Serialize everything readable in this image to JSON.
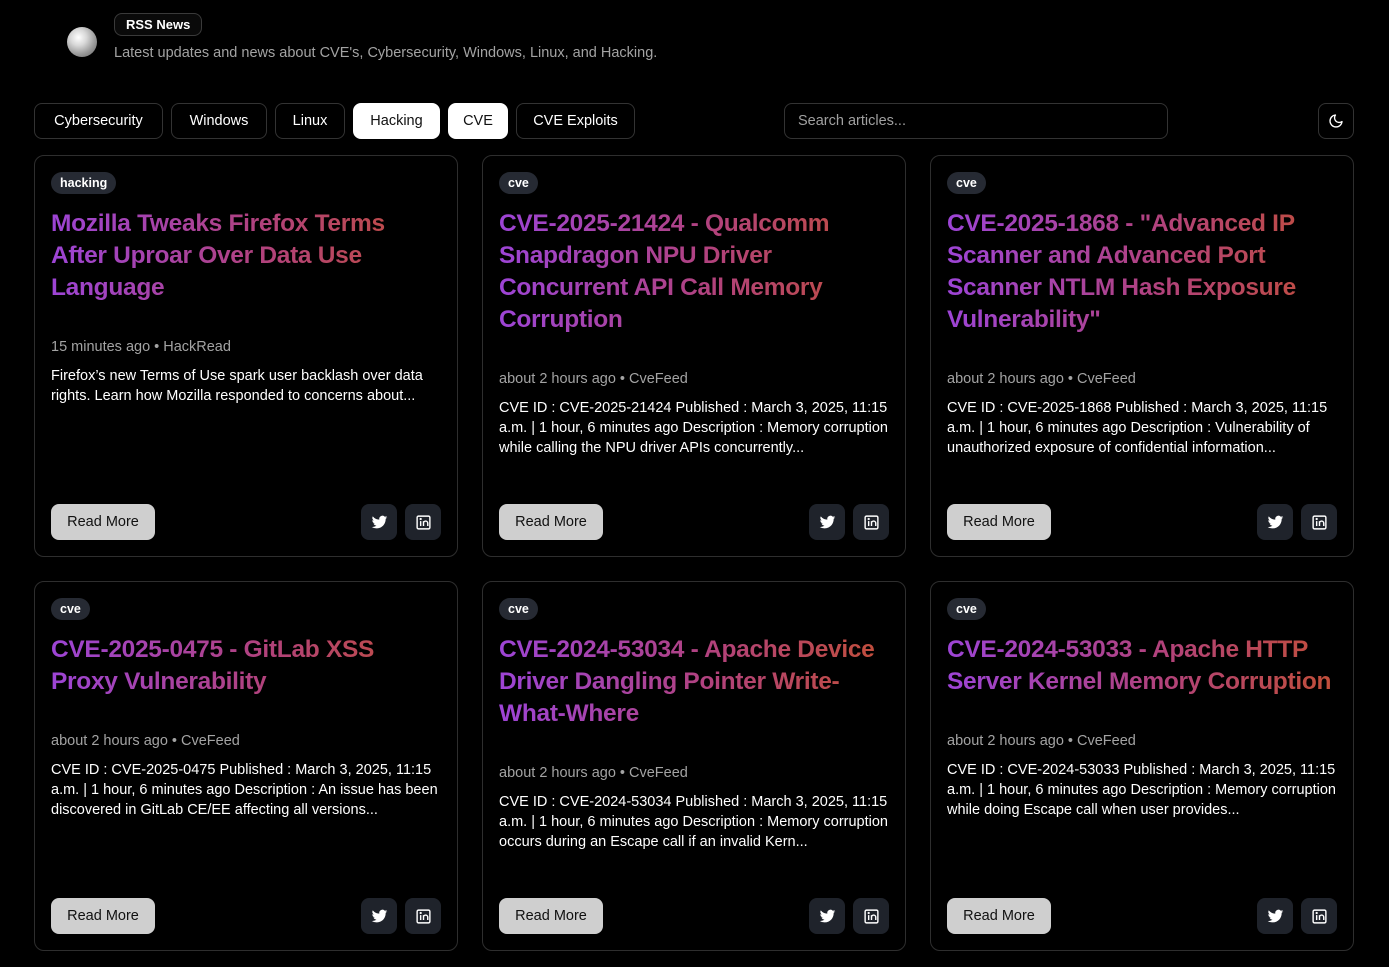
{
  "header": {
    "brand": "RSS News",
    "tagline": "Latest updates and news about CVE's, Cybersecurity, Windows, Linux, and Hacking.",
    "logo_icon": "globe-icon"
  },
  "filters": [
    {
      "label": "Cybersecurity",
      "active": false
    },
    {
      "label": "Windows",
      "active": false
    },
    {
      "label": "Linux",
      "active": false
    },
    {
      "label": "Hacking",
      "active": true
    },
    {
      "label": "CVE",
      "active": true
    },
    {
      "label": "CVE Exploits",
      "active": false
    }
  ],
  "search": {
    "placeholder": "Search articles...",
    "value": ""
  },
  "theme_toggle": {
    "icon": "moon-icon"
  },
  "colors": {
    "background": "#000000",
    "title_gradient_start": "#9d44d6",
    "title_gradient_end": "#c24f36",
    "tag_bg": "#262a33",
    "button_bg": "#cfcfcf"
  },
  "articles": [
    {
      "tag": "hacking",
      "title": "Mozilla Tweaks Firefox Terms After Uproar Over Data Use Language",
      "time": "15 minutes ago",
      "source": "HackRead",
      "summary": "Firefox’s new Terms of Use spark user backlash over data rights. Learn how Mozilla responded to concerns about...",
      "read_more": "Read More"
    },
    {
      "tag": "cve",
      "title": "CVE-2025-21424 - Qualcomm Snapdragon NPU Driver Concurrent API Call Memory Corruption",
      "time": "about 2 hours ago",
      "source": "CveFeed",
      "summary": "CVE ID : CVE-2025-21424 Published : March 3, 2025, 11:15 a.m. | 1 hour, 6 minutes ago Description : Memory corruption while calling the NPU driver APIs concurrently...",
      "read_more": "Read More"
    },
    {
      "tag": "cve",
      "title": "CVE-2025-1868 - \"Advanced IP Scanner and Advanced Port Scanner NTLM Hash Exposure Vulnerability\"",
      "time": "about 2 hours ago",
      "source": "CveFeed",
      "summary": "CVE ID : CVE-2025-1868 Published : March 3, 2025, 11:15 a.m. | 1 hour, 6 minutes ago Description : Vulnerability of unauthorized exposure of confidential information...",
      "read_more": "Read More"
    },
    {
      "tag": "cve",
      "title": "CVE-2025-0475 - GitLab XSS Proxy Vulnerability",
      "time": "about 2 hours ago",
      "source": "CveFeed",
      "summary": "CVE ID : CVE-2025-0475 Published : March 3, 2025, 11:15 a.m. | 1 hour, 6 minutes ago Description : An issue has been discovered in GitLab CE/EE affecting all versions...",
      "read_more": "Read More"
    },
    {
      "tag": "cve",
      "title": "CVE-2024-53034 - Apache Device Driver Dangling Pointer Write-What-Where",
      "time": "about 2 hours ago",
      "source": "CveFeed",
      "summary": "CVE ID : CVE-2024-53034 Published : March 3, 2025, 11:15 a.m. | 1 hour, 6 minutes ago Description : Memory corruption occurs during an Escape call if an invalid Kern...",
      "read_more": "Read More"
    },
    {
      "tag": "cve",
      "title": "CVE-2024-53033 - Apache HTTP Server Kernel Memory Corruption",
      "time": "about 2 hours ago",
      "source": "CveFeed",
      "summary": "CVE ID : CVE-2024-53033 Published : March 3, 2025, 11:15 a.m. | 1 hour, 6 minutes ago Description : Memory corruption while doing Escape call when user provides...",
      "read_more": "Read More"
    }
  ]
}
